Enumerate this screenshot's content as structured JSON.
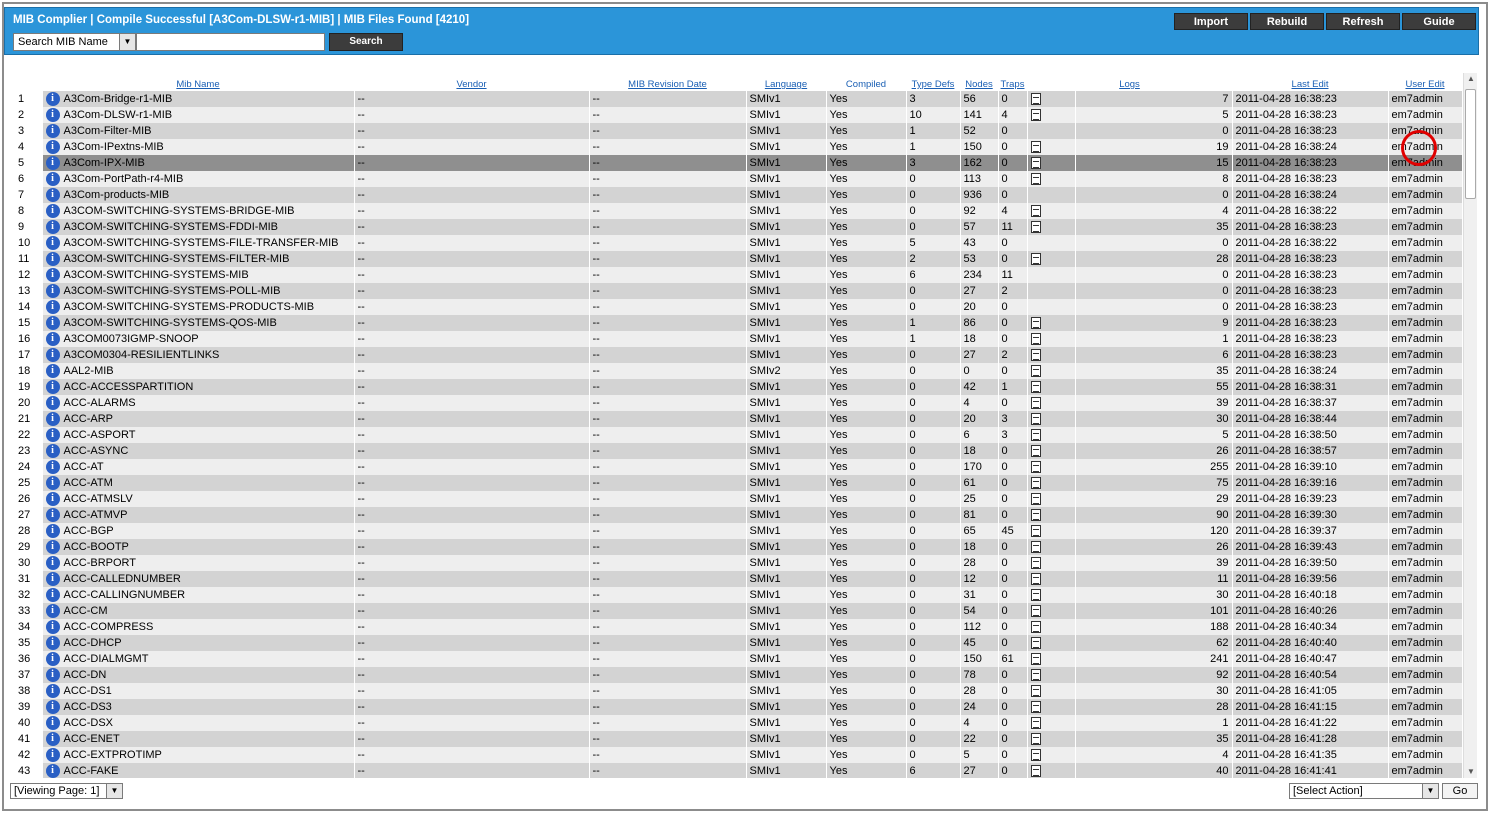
{
  "header": {
    "title": "MIB Complier | Compile Successful [A3Com-DLSW-r1-MIB] | MIB Files Found [4210]",
    "buttons": [
      {
        "label": "Import",
        "name": "import-button",
        "width": 74
      },
      {
        "label": "Rebuild",
        "name": "rebuild-button",
        "width": 74
      },
      {
        "label": "Refresh",
        "name": "refresh-button",
        "width": 74
      },
      {
        "label": "Guide",
        "name": "guide-button",
        "width": 74
      }
    ]
  },
  "search": {
    "field_select": "Search MIB Name",
    "input_value": "",
    "button_label": "Search"
  },
  "columns": [
    "Mib Name",
    "Vendor",
    "MIB Revision Date",
    "Language",
    "Compiled",
    "Type Defs",
    "Nodes",
    "Traps",
    "Logs",
    "Last Edit",
    "User Edit"
  ],
  "rows": [
    {
      "n": "1",
      "name": "A3Com-Bridge-r1-MIB",
      "vendor": "--",
      "rev": "--",
      "lang": "SMIv1",
      "compiled": "Yes",
      "td": "3",
      "nodes": "56",
      "traps": "0",
      "logs": "7",
      "edit": "2011-04-28 16:38:23",
      "user": "em7admin"
    },
    {
      "n": "2",
      "name": "A3Com-DLSW-r1-MIB",
      "vendor": "--",
      "rev": "--",
      "lang": "SMIv1",
      "compiled": "Yes",
      "td": "10",
      "nodes": "141",
      "traps": "4",
      "logs": "5",
      "edit": "2011-04-28 16:38:23",
      "user": "em7admin"
    },
    {
      "n": "3",
      "name": "A3Com-Filter-MIB",
      "vendor": "--",
      "rev": "--",
      "lang": "SMIv1",
      "compiled": "Yes",
      "td": "1",
      "nodes": "52",
      "traps": "0",
      "logs": "0",
      "edit": "2011-04-28 16:38:23",
      "user": "em7admin"
    },
    {
      "n": "4",
      "name": "A3Com-IPextns-MIB",
      "vendor": "--",
      "rev": "--",
      "lang": "SMIv1",
      "compiled": "Yes",
      "td": "1",
      "nodes": "150",
      "traps": "0",
      "logs": "19",
      "edit": "2011-04-28 16:38:24",
      "user": "em7admin"
    },
    {
      "n": "5",
      "name": "A3Com-IPX-MIB",
      "vendor": "--",
      "rev": "--",
      "lang": "SMIv1",
      "compiled": "Yes",
      "td": "3",
      "nodes": "162",
      "traps": "0",
      "logs": "15",
      "edit": "2011-04-28 16:38:23",
      "user": "em7admin"
    },
    {
      "n": "6",
      "name": "A3Com-PortPath-r4-MIB",
      "vendor": "--",
      "rev": "--",
      "lang": "SMIv1",
      "compiled": "Yes",
      "td": "0",
      "nodes": "113",
      "traps": "0",
      "logs": "8",
      "edit": "2011-04-28 16:38:23",
      "user": "em7admin"
    },
    {
      "n": "7",
      "name": "A3Com-products-MIB",
      "vendor": "--",
      "rev": "--",
      "lang": "SMIv1",
      "compiled": "Yes",
      "td": "0",
      "nodes": "936",
      "traps": "0",
      "logs": "0",
      "edit": "2011-04-28 16:38:24",
      "user": "em7admin"
    },
    {
      "n": "8",
      "name": "A3COM-SWITCHING-SYSTEMS-BRIDGE-MIB",
      "vendor": "--",
      "rev": "--",
      "lang": "SMIv1",
      "compiled": "Yes",
      "td": "0",
      "nodes": "92",
      "traps": "4",
      "logs": "4",
      "edit": "2011-04-28 16:38:22",
      "user": "em7admin"
    },
    {
      "n": "9",
      "name": "A3COM-SWITCHING-SYSTEMS-FDDI-MIB",
      "vendor": "--",
      "rev": "--",
      "lang": "SMIv1",
      "compiled": "Yes",
      "td": "0",
      "nodes": "57",
      "traps": "11",
      "logs": "35",
      "edit": "2011-04-28 16:38:23",
      "user": "em7admin"
    },
    {
      "n": "10",
      "name": "A3COM-SWITCHING-SYSTEMS-FILE-TRANSFER-MIB",
      "vendor": "--",
      "rev": "--",
      "lang": "SMIv1",
      "compiled": "Yes",
      "td": "5",
      "nodes": "43",
      "traps": "0",
      "logs": "0",
      "edit": "2011-04-28 16:38:22",
      "user": "em7admin"
    },
    {
      "n": "11",
      "name": "A3COM-SWITCHING-SYSTEMS-FILTER-MIB",
      "vendor": "--",
      "rev": "--",
      "lang": "SMIv1",
      "compiled": "Yes",
      "td": "2",
      "nodes": "53",
      "traps": "0",
      "logs": "28",
      "edit": "2011-04-28 16:38:23",
      "user": "em7admin"
    },
    {
      "n": "12",
      "name": "A3COM-SWITCHING-SYSTEMS-MIB",
      "vendor": "--",
      "rev": "--",
      "lang": "SMIv1",
      "compiled": "Yes",
      "td": "6",
      "nodes": "234",
      "traps": "11",
      "logs": "0",
      "edit": "2011-04-28 16:38:23",
      "user": "em7admin"
    },
    {
      "n": "13",
      "name": "A3COM-SWITCHING-SYSTEMS-POLL-MIB",
      "vendor": "--",
      "rev": "--",
      "lang": "SMIv1",
      "compiled": "Yes",
      "td": "0",
      "nodes": "27",
      "traps": "2",
      "logs": "0",
      "edit": "2011-04-28 16:38:23",
      "user": "em7admin"
    },
    {
      "n": "14",
      "name": "A3COM-SWITCHING-SYSTEMS-PRODUCTS-MIB",
      "vendor": "--",
      "rev": "--",
      "lang": "SMIv1",
      "compiled": "Yes",
      "td": "0",
      "nodes": "20",
      "traps": "0",
      "logs": "0",
      "edit": "2011-04-28 16:38:23",
      "user": "em7admin"
    },
    {
      "n": "15",
      "name": "A3COM-SWITCHING-SYSTEMS-QOS-MIB",
      "vendor": "--",
      "rev": "--",
      "lang": "SMIv1",
      "compiled": "Yes",
      "td": "1",
      "nodes": "86",
      "traps": "0",
      "logs": "9",
      "edit": "2011-04-28 16:38:23",
      "user": "em7admin"
    },
    {
      "n": "16",
      "name": "A3COM0073IGMP-SNOOP",
      "vendor": "--",
      "rev": "--",
      "lang": "SMIv1",
      "compiled": "Yes",
      "td": "1",
      "nodes": "18",
      "traps": "0",
      "logs": "1",
      "edit": "2011-04-28 16:38:23",
      "user": "em7admin"
    },
    {
      "n": "17",
      "name": "A3COM0304-RESILIENTLINKS",
      "vendor": "--",
      "rev": "--",
      "lang": "SMIv1",
      "compiled": "Yes",
      "td": "0",
      "nodes": "27",
      "traps": "2",
      "logs": "6",
      "edit": "2011-04-28 16:38:23",
      "user": "em7admin"
    },
    {
      "n": "18",
      "name": "AAL2-MIB",
      "vendor": "--",
      "rev": "--",
      "lang": "SMIv2",
      "compiled": "Yes",
      "td": "0",
      "nodes": "0",
      "traps": "0",
      "logs": "35",
      "edit": "2011-04-28 16:38:24",
      "user": "em7admin"
    },
    {
      "n": "19",
      "name": "ACC-ACCESSPARTITION",
      "vendor": "--",
      "rev": "--",
      "lang": "SMIv1",
      "compiled": "Yes",
      "td": "0",
      "nodes": "42",
      "traps": "1",
      "logs": "55",
      "edit": "2011-04-28 16:38:31",
      "user": "em7admin"
    },
    {
      "n": "20",
      "name": "ACC-ALARMS",
      "vendor": "--",
      "rev": "--",
      "lang": "SMIv1",
      "compiled": "Yes",
      "td": "0",
      "nodes": "4",
      "traps": "0",
      "logs": "39",
      "edit": "2011-04-28 16:38:37",
      "user": "em7admin"
    },
    {
      "n": "21",
      "name": "ACC-ARP",
      "vendor": "--",
      "rev": "--",
      "lang": "SMIv1",
      "compiled": "Yes",
      "td": "0",
      "nodes": "20",
      "traps": "3",
      "logs": "30",
      "edit": "2011-04-28 16:38:44",
      "user": "em7admin"
    },
    {
      "n": "22",
      "name": "ACC-ASPORT",
      "vendor": "--",
      "rev": "--",
      "lang": "SMIv1",
      "compiled": "Yes",
      "td": "0",
      "nodes": "6",
      "traps": "3",
      "logs": "5",
      "edit": "2011-04-28 16:38:50",
      "user": "em7admin"
    },
    {
      "n": "23",
      "name": "ACC-ASYNC",
      "vendor": "--",
      "rev": "--",
      "lang": "SMIv1",
      "compiled": "Yes",
      "td": "0",
      "nodes": "18",
      "traps": "0",
      "logs": "26",
      "edit": "2011-04-28 16:38:57",
      "user": "em7admin"
    },
    {
      "n": "24",
      "name": "ACC-AT",
      "vendor": "--",
      "rev": "--",
      "lang": "SMIv1",
      "compiled": "Yes",
      "td": "0",
      "nodes": "170",
      "traps": "0",
      "logs": "255",
      "edit": "2011-04-28 16:39:10",
      "user": "em7admin"
    },
    {
      "n": "25",
      "name": "ACC-ATM",
      "vendor": "--",
      "rev": "--",
      "lang": "SMIv1",
      "compiled": "Yes",
      "td": "0",
      "nodes": "61",
      "traps": "0",
      "logs": "75",
      "edit": "2011-04-28 16:39:16",
      "user": "em7admin"
    },
    {
      "n": "26",
      "name": "ACC-ATMSLV",
      "vendor": "--",
      "rev": "--",
      "lang": "SMIv1",
      "compiled": "Yes",
      "td": "0",
      "nodes": "25",
      "traps": "0",
      "logs": "29",
      "edit": "2011-04-28 16:39:23",
      "user": "em7admin"
    },
    {
      "n": "27",
      "name": "ACC-ATMVP",
      "vendor": "--",
      "rev": "--",
      "lang": "SMIv1",
      "compiled": "Yes",
      "td": "0",
      "nodes": "81",
      "traps": "0",
      "logs": "90",
      "edit": "2011-04-28 16:39:30",
      "user": "em7admin"
    },
    {
      "n": "28",
      "name": "ACC-BGP",
      "vendor": "--",
      "rev": "--",
      "lang": "SMIv1",
      "compiled": "Yes",
      "td": "0",
      "nodes": "65",
      "traps": "45",
      "logs": "120",
      "edit": "2011-04-28 16:39:37",
      "user": "em7admin"
    },
    {
      "n": "29",
      "name": "ACC-BOOTP",
      "vendor": "--",
      "rev": "--",
      "lang": "SMIv1",
      "compiled": "Yes",
      "td": "0",
      "nodes": "18",
      "traps": "0",
      "logs": "26",
      "edit": "2011-04-28 16:39:43",
      "user": "em7admin"
    },
    {
      "n": "30",
      "name": "ACC-BRPORT",
      "vendor": "--",
      "rev": "--",
      "lang": "SMIv1",
      "compiled": "Yes",
      "td": "0",
      "nodes": "28",
      "traps": "0",
      "logs": "39",
      "edit": "2011-04-28 16:39:50",
      "user": "em7admin"
    },
    {
      "n": "31",
      "name": "ACC-CALLEDNUMBER",
      "vendor": "--",
      "rev": "--",
      "lang": "SMIv1",
      "compiled": "Yes",
      "td": "0",
      "nodes": "12",
      "traps": "0",
      "logs": "11",
      "edit": "2011-04-28 16:39:56",
      "user": "em7admin"
    },
    {
      "n": "32",
      "name": "ACC-CALLINGNUMBER",
      "vendor": "--",
      "rev": "--",
      "lang": "SMIv1",
      "compiled": "Yes",
      "td": "0",
      "nodes": "31",
      "traps": "0",
      "logs": "30",
      "edit": "2011-04-28 16:40:18",
      "user": "em7admin"
    },
    {
      "n": "33",
      "name": "ACC-CM",
      "vendor": "--",
      "rev": "--",
      "lang": "SMIv1",
      "compiled": "Yes",
      "td": "0",
      "nodes": "54",
      "traps": "0",
      "logs": "101",
      "edit": "2011-04-28 16:40:26",
      "user": "em7admin"
    },
    {
      "n": "34",
      "name": "ACC-COMPRESS",
      "vendor": "--",
      "rev": "--",
      "lang": "SMIv1",
      "compiled": "Yes",
      "td": "0",
      "nodes": "112",
      "traps": "0",
      "logs": "188",
      "edit": "2011-04-28 16:40:34",
      "user": "em7admin"
    },
    {
      "n": "35",
      "name": "ACC-DHCP",
      "vendor": "--",
      "rev": "--",
      "lang": "SMIv1",
      "compiled": "Yes",
      "td": "0",
      "nodes": "45",
      "traps": "0",
      "logs": "62",
      "edit": "2011-04-28 16:40:40",
      "user": "em7admin"
    },
    {
      "n": "36",
      "name": "ACC-DIALMGMT",
      "vendor": "--",
      "rev": "--",
      "lang": "SMIv1",
      "compiled": "Yes",
      "td": "0",
      "nodes": "150",
      "traps": "61",
      "logs": "241",
      "edit": "2011-04-28 16:40:47",
      "user": "em7admin"
    },
    {
      "n": "37",
      "name": "ACC-DN",
      "vendor": "--",
      "rev": "--",
      "lang": "SMIv1",
      "compiled": "Yes",
      "td": "0",
      "nodes": "78",
      "traps": "0",
      "logs": "92",
      "edit": "2011-04-28 16:40:54",
      "user": "em7admin"
    },
    {
      "n": "38",
      "name": "ACC-DS1",
      "vendor": "--",
      "rev": "--",
      "lang": "SMIv1",
      "compiled": "Yes",
      "td": "0",
      "nodes": "28",
      "traps": "0",
      "logs": "30",
      "edit": "2011-04-28 16:41:05",
      "user": "em7admin"
    },
    {
      "n": "39",
      "name": "ACC-DS3",
      "vendor": "--",
      "rev": "--",
      "lang": "SMIv1",
      "compiled": "Yes",
      "td": "0",
      "nodes": "24",
      "traps": "0",
      "logs": "28",
      "edit": "2011-04-28 16:41:15",
      "user": "em7admin"
    },
    {
      "n": "40",
      "name": "ACC-DSX",
      "vendor": "--",
      "rev": "--",
      "lang": "SMIv1",
      "compiled": "Yes",
      "td": "0",
      "nodes": "4",
      "traps": "0",
      "logs": "1",
      "edit": "2011-04-28 16:41:22",
      "user": "em7admin"
    },
    {
      "n": "41",
      "name": "ACC-ENET",
      "vendor": "--",
      "rev": "--",
      "lang": "SMIv1",
      "compiled": "Yes",
      "td": "0",
      "nodes": "22",
      "traps": "0",
      "logs": "35",
      "edit": "2011-04-28 16:41:28",
      "user": "em7admin"
    },
    {
      "n": "42",
      "name": "ACC-EXTPROTIMP",
      "vendor": "--",
      "rev": "--",
      "lang": "SMIv1",
      "compiled": "Yes",
      "td": "0",
      "nodes": "5",
      "traps": "0",
      "logs": "4",
      "edit": "2011-04-28 16:41:35",
      "user": "em7admin"
    },
    {
      "n": "43",
      "name": "ACC-FAKE",
      "vendor": "--",
      "rev": "--",
      "lang": "SMIv1",
      "compiled": "Yes",
      "td": "6",
      "nodes": "27",
      "traps": "0",
      "logs": "40",
      "edit": "2011-04-28 16:41:41",
      "user": "em7admin"
    }
  ],
  "footer": {
    "page_select": "[Viewing Page: 1]",
    "action_select": "[Select Action]",
    "go_label": "Go"
  },
  "colors": {
    "header_bg": "#2b95d9",
    "button_bg": "#3c3c3c",
    "highlight": "#e00000"
  }
}
